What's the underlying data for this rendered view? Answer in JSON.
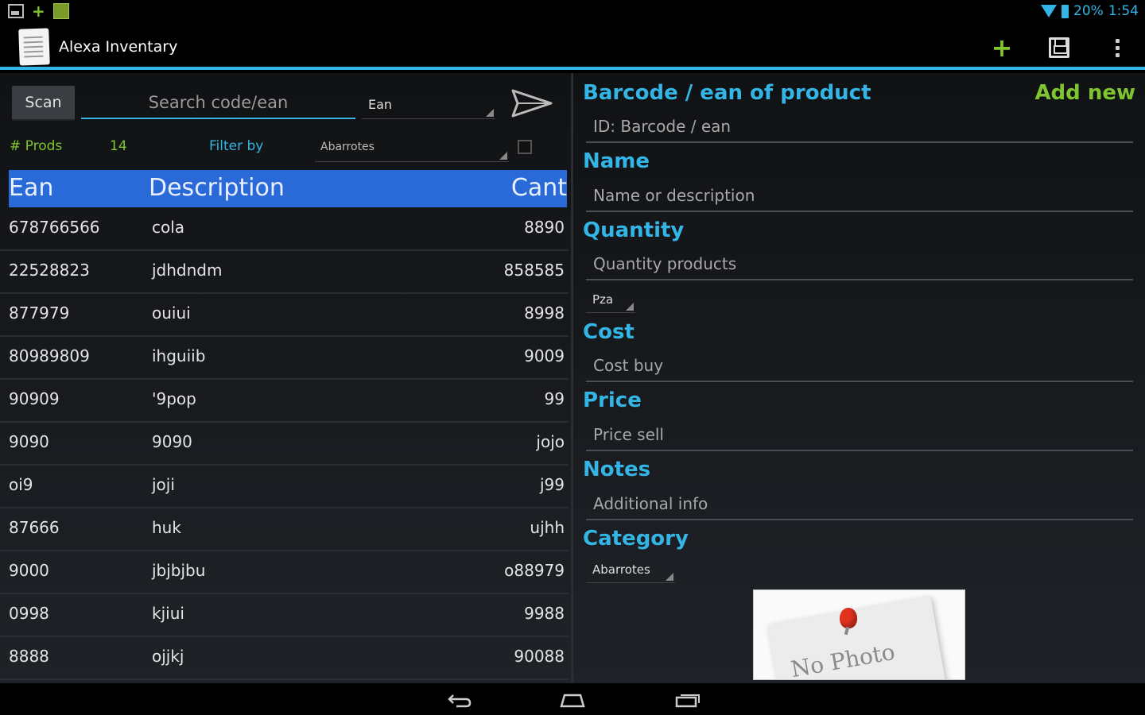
{
  "status_bar": {
    "battery": "20%",
    "time": "1:54"
  },
  "app": {
    "title": "Alexa Inventary"
  },
  "toolbar": {
    "add_icon": "plus-icon",
    "save_icon": "save-icon",
    "overflow_icon": "more-vert-icon"
  },
  "search": {
    "scan_label": "Scan",
    "placeholder": "Search code/ean",
    "type_selected": "Ean"
  },
  "filter": {
    "prods_label": "# Prods",
    "prods_count": "14",
    "filter_label": "Filter by",
    "category_selected": "Abarrotes"
  },
  "table": {
    "headers": {
      "ean": "Ean",
      "description": "Description",
      "cant": "Cant"
    },
    "rows": [
      {
        "ean": "678766566",
        "description": "cola",
        "cant": "8890"
      },
      {
        "ean": "22528823",
        "description": "jdhdndm",
        "cant": "858585"
      },
      {
        "ean": "877979",
        "description": "ouiui",
        "cant": "8998"
      },
      {
        "ean": "80989809",
        "description": "ihguiib",
        "cant": "9009"
      },
      {
        "ean": "90909",
        "description": "'9pop",
        "cant": "99"
      },
      {
        "ean": "9090",
        "description": "9090",
        "cant": "jojo"
      },
      {
        "ean": "oi9",
        "description": "joji",
        "cant": "j99"
      },
      {
        "ean": "87666",
        "description": "huk",
        "cant": "ujhh"
      },
      {
        "ean": "9000",
        "description": "jbjbjbu",
        "cant": "o88979"
      },
      {
        "ean": "0998",
        "description": "kjiui",
        "cant": "9988"
      },
      {
        "ean": "8888",
        "description": "ojjkj",
        "cant": "90088"
      }
    ]
  },
  "form": {
    "add_new": "Add new",
    "barcode_label": "Barcode / ean of product",
    "barcode_placeholder": "ID: Barcode / ean",
    "name_label": "Name",
    "name_placeholder": "Name or description",
    "quantity_label": "Quantity",
    "quantity_placeholder": "Quantity products",
    "unit_selected": "Pza",
    "cost_label": "Cost",
    "cost_placeholder": "Cost buy",
    "price_label": "Price",
    "price_placeholder": "Price sell",
    "notes_label": "Notes",
    "notes_placeholder": "Additional info",
    "category_label": "Category",
    "category_selected": "Abarrotes",
    "photo_text": "No Photo"
  },
  "colors": {
    "accent": "#33b5e5",
    "green": "#7fc52f",
    "header": "#2a6ad8"
  }
}
